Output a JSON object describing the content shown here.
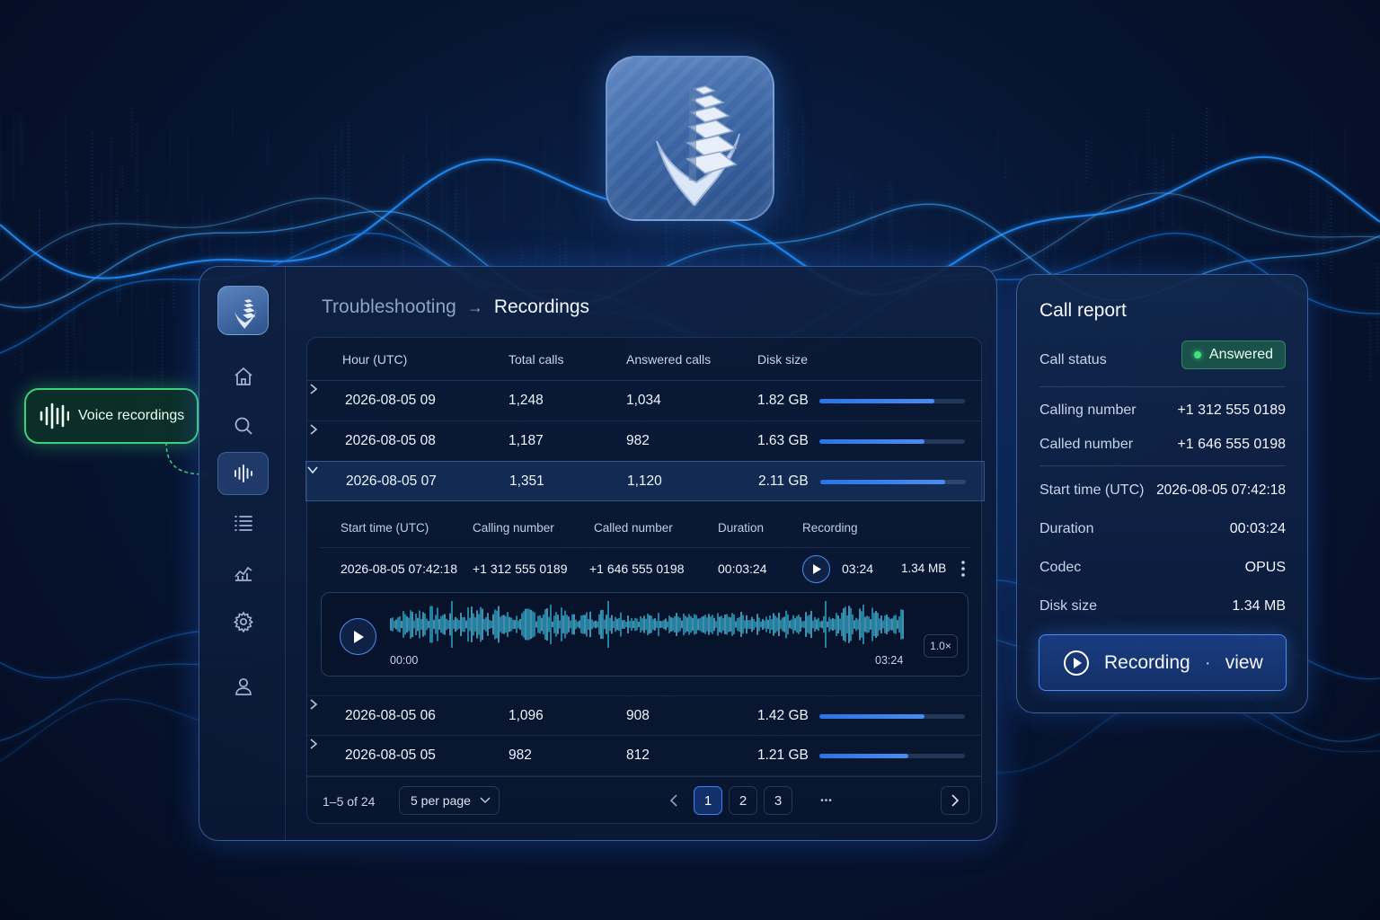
{
  "callout": {
    "label": "Voice recordings"
  },
  "breadcrumb": {
    "parent": "Troubleshooting",
    "separator": "→",
    "current": "Recordings"
  },
  "sidebar": {
    "items": [
      "home-icon",
      "search-icon",
      "waveform-icon",
      "list-icon",
      "chart-icon",
      "gear-icon",
      "user-icon"
    ],
    "active": "waveform-icon"
  },
  "table": {
    "headers": {
      "hour": "Hour (UTC)",
      "total": "Total calls",
      "answered": "Answered calls",
      "disk": "Disk size"
    },
    "rows": [
      {
        "hour": "2026-08-05 09",
        "total": "1,248",
        "answered": "1,034",
        "disk": "1.82 GB",
        "usage": 0.79
      },
      {
        "hour": "2026-08-05 08",
        "total": "1,187",
        "answered": "982",
        "disk": "1.63 GB",
        "usage": 0.72
      },
      {
        "hour": "2026-08-05 07",
        "total": "1,351",
        "answered": "1,120",
        "disk": "2.11 GB",
        "usage": 0.86
      },
      {
        "hour": "2026-08-05 06",
        "total": "1,096",
        "answered": "908",
        "disk": "1.42 GB",
        "usage": 0.72
      },
      {
        "hour": "2026-08-05 05",
        "total": "982",
        "answered": "812",
        "disk": "1.21 GB",
        "usage": 0.61
      }
    ],
    "detail": {
      "headers": {
        "start": "Start time (UTC)",
        "calling": "Calling number",
        "called": "Called number",
        "duration": "Duration",
        "recording": "Recording"
      },
      "row": {
        "start": "2026-08-05 07:42:18",
        "calling": "+1 312 555 0189",
        "called": "+1 646 555 0198",
        "duration": "00:03:24",
        "rec_length": "03:24",
        "size": "1.34 MB"
      }
    },
    "player": {
      "time_start": "00:00",
      "time_end": "03:24",
      "speed": "1.0×"
    },
    "footer": {
      "range": "1–5 of 24",
      "per_page": "5 per page",
      "pages": [
        "1",
        "2",
        "3"
      ],
      "ellipsis": "•••",
      "current_page": "1"
    }
  },
  "call_report": {
    "title": "Call report",
    "status_label": "Call status",
    "status_value": "Answered",
    "calling_label": "Calling number",
    "calling_value": "+1 312 555 0189",
    "called_label": "Called number",
    "called_value": "+1 646 555 0198",
    "start_label": "Start time (UTC)",
    "start_value": "2026-08-05 07:42:18",
    "duration_label": "Duration",
    "duration_value": "00:03:24",
    "codec_label": "Codec",
    "codec_value": "OPUS",
    "disk_label": "Disk size",
    "disk_value": "1.34 MB",
    "button_left": "Recording",
    "button_sep": "·",
    "button_right": "view"
  },
  "colors": {
    "accent": "#3b82f6",
    "success": "#3fe07f",
    "background": "#071634"
  }
}
